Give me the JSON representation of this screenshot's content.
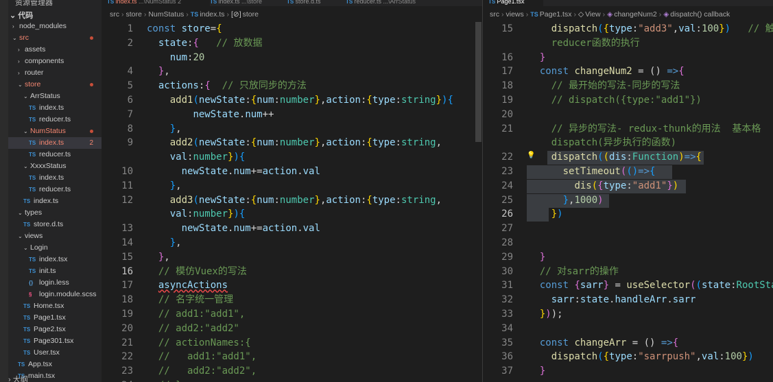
{
  "sidebar": {
    "top_label": "资源管理器",
    "root_label": "代码",
    "bottom_label": "大纲",
    "items": [
      {
        "label": "node_modules",
        "depth": 1,
        "folder": true,
        "open": false
      },
      {
        "label": "src",
        "depth": 1,
        "folder": true,
        "open": true,
        "err": true,
        "dot": true
      },
      {
        "label": "assets",
        "depth": 2,
        "folder": true,
        "open": false
      },
      {
        "label": "components",
        "depth": 2,
        "folder": true,
        "open": false
      },
      {
        "label": "router",
        "depth": 2,
        "folder": true,
        "open": false
      },
      {
        "label": "store",
        "depth": 2,
        "folder": true,
        "open": true,
        "err": true,
        "dot": true
      },
      {
        "label": "ArrStatus",
        "depth": 3,
        "folder": true,
        "open": true
      },
      {
        "label": "index.ts",
        "depth": 4,
        "icon": "TS"
      },
      {
        "label": "reducer.ts",
        "depth": 4,
        "icon": "TS"
      },
      {
        "label": "NumStatus",
        "depth": 3,
        "folder": true,
        "open": true,
        "err": true,
        "dot": true
      },
      {
        "label": "index.ts",
        "depth": 4,
        "icon": "TS",
        "err": true,
        "selected": true,
        "badge": "2"
      },
      {
        "label": "reducer.ts",
        "depth": 4,
        "icon": "TS"
      },
      {
        "label": "XxxxStatus",
        "depth": 3,
        "folder": true,
        "open": true
      },
      {
        "label": "index.ts",
        "depth": 4,
        "icon": "TS"
      },
      {
        "label": "reducer.ts",
        "depth": 4,
        "icon": "TS"
      },
      {
        "label": "index.ts",
        "depth": 3,
        "icon": "TS"
      },
      {
        "label": "types",
        "depth": 2,
        "folder": true,
        "open": true
      },
      {
        "label": "store.d.ts",
        "depth": 3,
        "icon": "TS"
      },
      {
        "label": "views",
        "depth": 2,
        "folder": true,
        "open": true
      },
      {
        "label": "Login",
        "depth": 3,
        "folder": true,
        "open": true
      },
      {
        "label": "index.tsx",
        "depth": 4,
        "icon": "TS"
      },
      {
        "label": "init.ts",
        "depth": 4,
        "icon": "TS"
      },
      {
        "label": "login.less",
        "depth": 4,
        "icon": "{}"
      },
      {
        "label": "login.module.scss",
        "depth": 4,
        "icon": "§"
      },
      {
        "label": "Home.tsx",
        "depth": 3,
        "icon": "TS"
      },
      {
        "label": "Page1.tsx",
        "depth": 3,
        "icon": "TS"
      },
      {
        "label": "Page2.tsx",
        "depth": 3,
        "icon": "TS"
      },
      {
        "label": "Page301.tsx",
        "depth": 3,
        "icon": "TS"
      },
      {
        "label": "User.tsx",
        "depth": 3,
        "icon": "TS"
      },
      {
        "label": "App.tsx",
        "depth": 2,
        "icon": "TS"
      },
      {
        "label": "main.tsx",
        "depth": 2,
        "icon": "TS"
      }
    ]
  },
  "left_editor": {
    "tabs": [
      {
        "label": "index.ts",
        "sub": "...\\NumStatus 2",
        "active": true,
        "err": true
      },
      {
        "label": "index.ts",
        "sub": "...\\store",
        "active": false
      },
      {
        "label": "store.d.ts",
        "sub": "",
        "active": false
      },
      {
        "label": "reducer.ts",
        "sub": "...\\ArrStatus",
        "active": false
      }
    ],
    "breadcrumb": [
      "src",
      "store",
      "NumStatus",
      "index.ts",
      "store"
    ],
    "lines": [
      {
        "n": "1",
        "h": "<span class='k'>const</span> <span class='v'>store</span>=<span class='b1'>{</span>"
      },
      {
        "n": "2",
        "h": "  <span class='v'>state</span>:<span class='b2'>{</span>   <span class='c'>// 放数据</span>"
      },
      {
        "n": "",
        "h": "    <span class='v'>num</span>:<span class='n'>20</span>"
      },
      {
        "n": "4",
        "h": "  <span class='b2'>}</span>,"
      },
      {
        "n": "5",
        "h": "  <span class='v'>actions</span>:<span class='b2'>{</span>  <span class='c'>// 只放同步的方法</span>"
      },
      {
        "n": "6",
        "h": "    <span class='f'>add1</span><span class='b3'>(</span><span class='v'>newState</span>:<span class='b1'>{</span><span class='v'>num</span>:<span class='t'>number</span><span class='b1'>}</span>,<span class='v'>action</span>:<span class='b1'>{</span><span class='v'>type</span>:<span class='t'>string</span><span class='b1'>}</span><span class='b3'>)</span><span class='b3'>{</span>"
      },
      {
        "n": "7",
        "h": "        <span class='v'>newState</span>.<span class='v'>num</span>++"
      },
      {
        "n": "8",
        "h": "    <span class='b3'>}</span>,"
      },
      {
        "n": "9",
        "h": "    <span class='f'>add2</span><span class='b3'>(</span><span class='v'>newState</span>:<span class='b1'>{</span><span class='v'>num</span>:<span class='t'>number</span><span class='b1'>}</span>,<span class='v'>action</span>:<span class='b1'>{</span><span class='v'>type</span>:<span class='t'>string</span>,"
      },
      {
        "n": "",
        "h": "    <span class='v'>val</span>:<span class='t'>number</span><span class='b1'>}</span><span class='b3'>)</span><span class='b3'>{</span>"
      },
      {
        "n": "10",
        "h": "      <span class='v'>newState</span>.<span class='v'>num</span>+=<span class='v'>action</span>.<span class='v'>val</span>"
      },
      {
        "n": "11",
        "h": "    <span class='b3'>}</span>,"
      },
      {
        "n": "12",
        "h": "    <span class='f'>add3</span><span class='b3'>(</span><span class='v'>newState</span>:<span class='b1'>{</span><span class='v'>num</span>:<span class='t'>number</span><span class='b1'>}</span>,<span class='v'>action</span>:<span class='b1'>{</span><span class='v'>type</span>:<span class='t'>string</span>,"
      },
      {
        "n": "",
        "h": "    <span class='v'>val</span>:<span class='t'>number</span><span class='b1'>}</span><span class='b3'>)</span><span class='b3'>{</span>"
      },
      {
        "n": "13",
        "h": "      <span class='v'>newState</span>.<span class='v'>num</span>+=<span class='v'>action</span>.<span class='v'>val</span>"
      },
      {
        "n": "14",
        "h": "    <span class='b3'>}</span>,"
      },
      {
        "n": "15",
        "h": "  <span class='b2'>}</span>,"
      },
      {
        "n": "16",
        "h": "  <span class='c'>// 模仿Vuex的写法</span>",
        "cur": true
      },
      {
        "n": "17",
        "h": "  <span class='v sq'>asyncActions</span>"
      },
      {
        "n": "18",
        "h": "  <span class='c'>// 名字统一管理</span>"
      },
      {
        "n": "19",
        "h": "  <span class='c'>// add1:\"add1\",</span>"
      },
      {
        "n": "20",
        "h": "  <span class='c'>// add2:\"add2\"</span>"
      },
      {
        "n": "21",
        "h": "  <span class='c'>// actionNames:{</span>"
      },
      {
        "n": "22",
        "h": "  <span class='c'>//   add1:\"add1\",</span>"
      },
      {
        "n": "23",
        "h": "  <span class='c'>//   add2:\"add2\",</span>"
      },
      {
        "n": "24",
        "h": "  <span class='c'>// }</span>"
      }
    ]
  },
  "right_editor": {
    "tabs": [
      {
        "label": "Page1.tsx",
        "active": true
      }
    ],
    "breadcrumb": [
      "src",
      "views",
      "Page1.tsx",
      "View",
      "changeNum2",
      "dispatch() callback"
    ],
    "lines": [
      {
        "n": "15",
        "h": "    <span class='f'>dispatch</span><span class='b3'>(</span><span class='b1'>{</span><span class='v'>type</span>:<span class='s'>\"add3\"</span>,<span class='v'>val</span>:<span class='n'>100</span><span class='b1'>}</span><span class='b3'>)</span>   <span class='c'>// 触</span>"
      },
      {
        "n": "",
        "h": "    <span class='c'>reducer函数的执行</span>"
      },
      {
        "n": "16",
        "h": "  <span class='b2'>}</span>"
      },
      {
        "n": "17",
        "h": "  <span class='k'>const</span> <span class='f'>changeNum2</span> = () <span class='k'>=&gt;</span><span class='b2'>{</span>"
      },
      {
        "n": "18",
        "h": "    <span class='c'>// 最开始的写法-同步的写法</span>"
      },
      {
        "n": "19",
        "h": "    <span class='c'>// dispatch({type:\"add1\"})</span>"
      },
      {
        "n": "20",
        "h": ""
      },
      {
        "n": "21",
        "h": "    <span class='c'>// 异步的写法- redux-thunk的用法  基本格</span>"
      },
      {
        "n": "",
        "h": "    <span class='c'>dispatch(异步执行的函数)</span>"
      },
      {
        "n": "22",
        "h": "    <span class='f'>dispatch</span><span class='b3'>(</span><span class='b1'>(</span><span class='v'>dis</span>:<span class='t'>Function</span><span class='b1'>)</span><span class='k'>=&gt;</span><span class='b1'>{</span>"
      },
      {
        "n": "23",
        "h": "      <span class='f'>setTimeout</span><span class='b2'>(</span><span class='b3'>()</span><span class='k'>=&gt;</span><span class='b3'>{</span>"
      },
      {
        "n": "24",
        "h": "        <span class='f'>dis</span><span class='b1'>(</span><span class='b2'>{</span><span class='v'>type</span>:<span class='s'>\"add1\"</span><span class='b2'>}</span><span class='b1'>)</span>"
      },
      {
        "n": "25",
        "h": "      <span class='b3'>}</span>,<span class='n'>1000</span><span class='b2'>)</span>"
      },
      {
        "n": "26",
        "h": "    <span class='b1'>}</span><span class='b3'>)</span>",
        "cur": true
      },
      {
        "n": "27",
        "h": ""
      },
      {
        "n": "28",
        "h": ""
      },
      {
        "n": "29",
        "h": "  <span class='b2'>}</span>"
      },
      {
        "n": "30",
        "h": "  <span class='c'>// 对sarr的操作</span>"
      },
      {
        "n": "31",
        "h": "  <span class='k'>const</span> <span class='b2'>{</span><span class='v'>sarr</span><span class='b2'>}</span> = <span class='f'>useSelector</span><span class='b2'>(</span><span class='b3'>(</span><span class='v'>state</span>:<span class='t'>RootSta</span>"
      },
      {
        "n": "32",
        "h": "    <span class='v'>sarr</span>:<span class='v'>state</span>.<span class='v'>handleArr</span>.<span class='v'>sarr</span>"
      },
      {
        "n": "33",
        "h": "  <span class='b1'>}</span><span class='b2'>)</span>);"
      },
      {
        "n": "34",
        "h": ""
      },
      {
        "n": "35",
        "h": "  <span class='k'>const</span> <span class='f'>changeArr</span> = () <span class='k'>=&gt;</span><span class='b2'>{</span>"
      },
      {
        "n": "36",
        "h": "    <span class='f'>dispatch</span><span class='b3'>(</span><span class='b1'>{</span><span class='v'>type</span>:<span class='s'>\"sarrpush\"</span>,<span class='v'>val</span>:<span class='n'>100</span><span class='b1'>}</span><span class='b3'>)</span>"
      },
      {
        "n": "37",
        "h": "  <span class='b2'>}</span>"
      }
    ]
  }
}
